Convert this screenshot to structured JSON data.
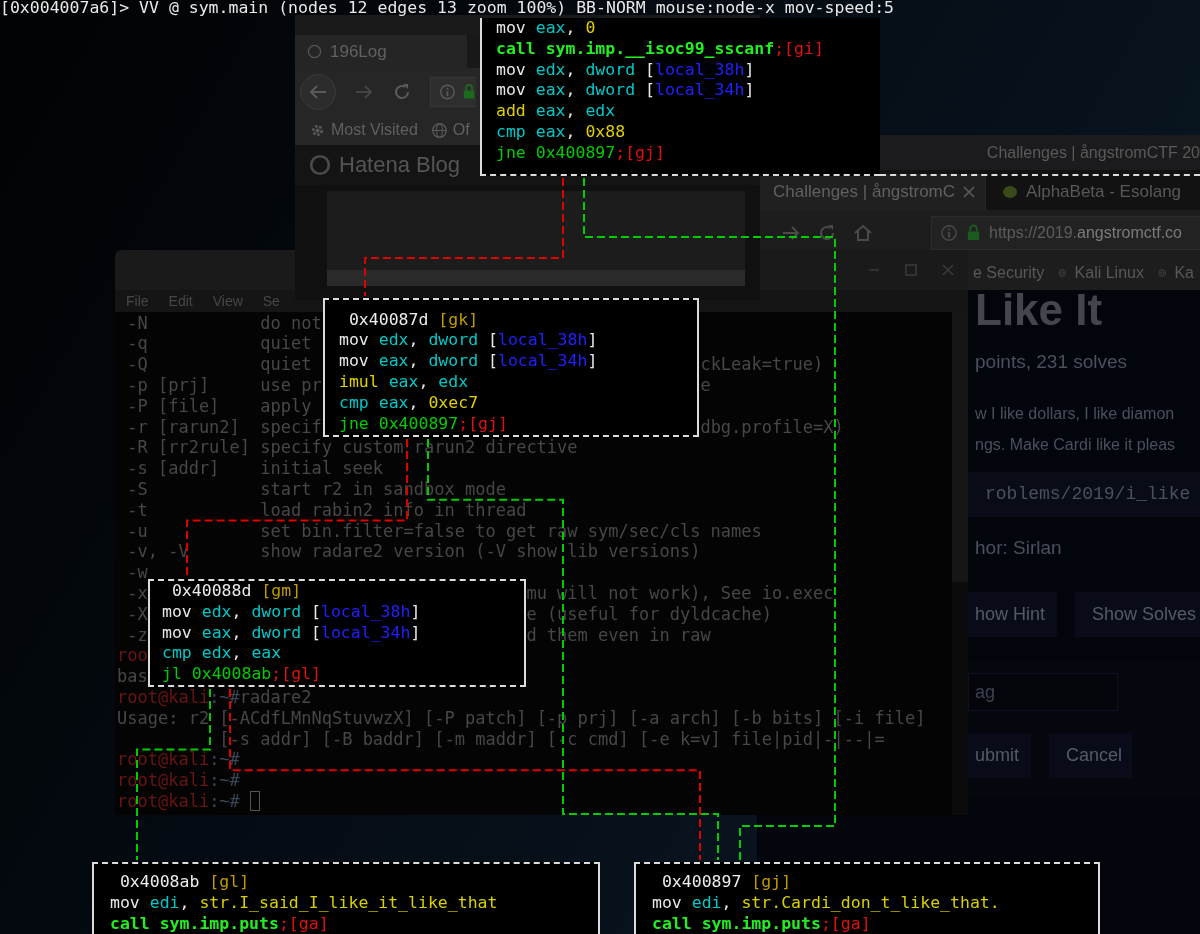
{
  "status_line": "[0x004007a6]> VV @ sym.main (nodes 12 edges 13 zoom 100%) BB-NORM mouse:node-x mov-speed:5",
  "browser_back": {
    "title": "Challenges | ångstromCTF 20",
    "tabs": [
      {
        "label": "Challenges | ångstromC",
        "selected": true
      },
      {
        "label": "AlphaBeta - Esolang",
        "selected": false
      }
    ],
    "url": {
      "dim_part": "https://2019.",
      "domain_part": "angstromctf.co"
    },
    "bookmarks": [
      "e Security",
      "Kali Linux",
      "Ka"
    ],
    "page": {
      "heading": "Like It",
      "meta": "points, 231 solves",
      "description": [
        "w I like dollars, I like diamon",
        "ngs. Make Cardi like it pleas"
      ],
      "path": "roblems/2019/i_like",
      "author": "hor: Sirlan",
      "buttons": [
        "how Hint",
        "Show Solves"
      ],
      "flag_placeholder": "ag",
      "form_buttons": [
        "ubmit",
        "Cancel"
      ]
    }
  },
  "terminal": {
    "menu": [
      "File",
      "Edit",
      "View",
      "Se"
    ],
    "lines": [
      {
        "kind": "help",
        "option": "-N",
        "text": "do not"
      },
      {
        "kind": "help",
        "option": "-q",
        "text": "quiet"
      },
      {
        "kind": "help",
        "option": "-Q",
        "text": "quiet",
        "tail": "ckLeak=true)"
      },
      {
        "kind": "help",
        "option": "-p [prj]",
        "text": "use pr",
        "tail": "e"
      },
      {
        "kind": "help",
        "option": "-P [file]",
        "text": "apply"
      },
      {
        "kind": "help",
        "option": "-r [rarun2]",
        "text": "specif",
        "tail": "dbg.profile=X)"
      },
      {
        "kind": "help",
        "option": "-R [rr2rule]",
        "text": "specify custom rarun2 directive"
      },
      {
        "kind": "help",
        "option": "-s [addr]",
        "text": "initial seek"
      },
      {
        "kind": "help",
        "option": "-S",
        "text": "start r2 in sandbox mode"
      },
      {
        "kind": "help",
        "option": "-t",
        "text": "load rabin2 info in thread"
      },
      {
        "kind": "help",
        "option": "-u",
        "text": "set bin.filter=false to get raw sym/sec/cls names"
      },
      {
        "kind": "help",
        "option": "-v, -V",
        "text": "show radare2 version (-V show lib versions)"
      },
      {
        "kind": "help",
        "option": "-w"
      },
      {
        "kind": "help",
        "option": "-x",
        "tail": "mu will not work), See io.exec"
      },
      {
        "kind": "help",
        "option": "-X",
        "tail": "e (useful for dyldcache)"
      },
      {
        "kind": "help",
        "option": "-z",
        "tail": "d them even in raw"
      },
      {
        "kind": "prompt",
        "user": "roo",
        "cursor": false
      },
      {
        "kind": "output",
        "text": "bas"
      },
      {
        "kind": "prompt",
        "user": "root@kali",
        "path": ":~#",
        "command": "radare2",
        "cursor": false
      },
      {
        "kind": "output",
        "text": "Usage: r2 [-ACdfLMnNqStuvwzX] [-P patch] [-p prj] [-a arch] [-b bits] [-i file]"
      },
      {
        "kind": "continuation",
        "text": "[-s addr] [-B baddr] [-m maddr] [-c cmd] [-e k=v] file|pid|-|--|="
      },
      {
        "kind": "prompt",
        "user": "root@kali",
        "path": ":~#",
        "cursor": false
      },
      {
        "kind": "prompt",
        "user": "root@kali",
        "path": ":~#",
        "cursor": false
      },
      {
        "kind": "prompt",
        "user": "root@kali",
        "path": ":~#",
        "cursor": true
      }
    ]
  },
  "browser_front": {
    "tab": "196Log",
    "bookmarks": [
      "Most Visited",
      "Of"
    ],
    "site_logo": "Hatena Blog"
  },
  "graph": {
    "nodes": [
      {
        "lines": [
          [
            {
              "text": "mov ",
              "kind": "op"
            },
            {
              "text": "eax",
              "kind": "reg"
            },
            {
              "text": ", ",
              "kind": "op"
            },
            {
              "text": "0",
              "kind": "num"
            }
          ],
          [
            {
              "text": "call sym.imp.__isoc99_sscanf",
              "kind": "call"
            },
            {
              "text": ";[gi]",
              "kind": "ref"
            }
          ],
          [
            {
              "text": "mov ",
              "kind": "op"
            },
            {
              "text": "edx",
              "kind": "reg"
            },
            {
              "text": ", ",
              "kind": "op"
            },
            {
              "text": "dword",
              "kind": "reg"
            },
            {
              "text": " [",
              "kind": "op"
            },
            {
              "text": "local_38h",
              "kind": "var"
            },
            {
              "text": "]",
              "kind": "op"
            }
          ],
          [
            {
              "text": "mov ",
              "kind": "op"
            },
            {
              "text": "eax",
              "kind": "reg"
            },
            {
              "text": ", ",
              "kind": "op"
            },
            {
              "text": "dword",
              "kind": "reg"
            },
            {
              "text": " [",
              "kind": "op"
            },
            {
              "text": "local_34h",
              "kind": "var"
            },
            {
              "text": "]",
              "kind": "op"
            }
          ],
          [
            {
              "text": "add ",
              "kind": "arith"
            },
            {
              "text": "eax",
              "kind": "reg"
            },
            {
              "text": ", ",
              "kind": "op"
            },
            {
              "text": "edx",
              "kind": "reg"
            }
          ],
          [
            {
              "text": "cmp ",
              "kind": "cmp"
            },
            {
              "text": "eax",
              "kind": "reg"
            },
            {
              "text": ", ",
              "kind": "op"
            },
            {
              "text": "0x88",
              "kind": "num"
            }
          ],
          [
            {
              "text": "jne 0x400897",
              "kind": "jmp"
            },
            {
              "text": ";[gj]",
              "kind": "ref"
            }
          ]
        ]
      },
      {
        "header": {
          "addr": "0x40087d",
          "label": "[gk]"
        },
        "lines": [
          [
            {
              "text": "mov ",
              "kind": "op"
            },
            {
              "text": "edx",
              "kind": "reg"
            },
            {
              "text": ", ",
              "kind": "op"
            },
            {
              "text": "dword",
              "kind": "reg"
            },
            {
              "text": " [",
              "kind": "op"
            },
            {
              "text": "local_38h",
              "kind": "var"
            },
            {
              "text": "]",
              "kind": "op"
            }
          ],
          [
            {
              "text": "mov ",
              "kind": "op"
            },
            {
              "text": "eax",
              "kind": "reg"
            },
            {
              "text": ", ",
              "kind": "op"
            },
            {
              "text": "dword",
              "kind": "reg"
            },
            {
              "text": " [",
              "kind": "op"
            },
            {
              "text": "local_34h",
              "kind": "var"
            },
            {
              "text": "]",
              "kind": "op"
            }
          ],
          [
            {
              "text": "imul ",
              "kind": "arith"
            },
            {
              "text": "eax",
              "kind": "reg"
            },
            {
              "text": ", ",
              "kind": "op"
            },
            {
              "text": "edx",
              "kind": "reg"
            }
          ],
          [
            {
              "text": "cmp ",
              "kind": "cmp"
            },
            {
              "text": "eax",
              "kind": "reg"
            },
            {
              "text": ", ",
              "kind": "op"
            },
            {
              "text": "0xec7",
              "kind": "num"
            }
          ],
          [
            {
              "text": "jne 0x400897",
              "kind": "jmp"
            },
            {
              "text": ";[gj]",
              "kind": "ref"
            }
          ]
        ]
      },
      {
        "header": {
          "addr": "0x40088d",
          "label": "[gm]"
        },
        "lines": [
          [
            {
              "text": "mov ",
              "kind": "op"
            },
            {
              "text": "edx",
              "kind": "reg"
            },
            {
              "text": ", ",
              "kind": "op"
            },
            {
              "text": "dword",
              "kind": "reg"
            },
            {
              "text": " [",
              "kind": "op"
            },
            {
              "text": "local_38h",
              "kind": "var"
            },
            {
              "text": "]",
              "kind": "op"
            }
          ],
          [
            {
              "text": "mov ",
              "kind": "op"
            },
            {
              "text": "eax",
              "kind": "reg"
            },
            {
              "text": ", ",
              "kind": "op"
            },
            {
              "text": "dword",
              "kind": "reg"
            },
            {
              "text": " [",
              "kind": "op"
            },
            {
              "text": "local_34h",
              "kind": "var"
            },
            {
              "text": "]",
              "kind": "op"
            }
          ],
          [
            {
              "text": "cmp ",
              "kind": "cmp"
            },
            {
              "text": "edx",
              "kind": "reg"
            },
            {
              "text": ", ",
              "kind": "op"
            },
            {
              "text": "eax",
              "kind": "reg"
            }
          ],
          [
            {
              "text": "jl 0x4008ab",
              "kind": "jmp"
            },
            {
              "text": ";[gl]",
              "kind": "ref"
            }
          ]
        ]
      },
      {
        "header": {
          "addr": "0x4008ab",
          "label": "[gl]"
        },
        "lines": [
          [
            {
              "text": "mov ",
              "kind": "op"
            },
            {
              "text": "edi",
              "kind": "reg"
            },
            {
              "text": ", ",
              "kind": "op"
            },
            {
              "text": "str.I_said_I_like_it_like_that",
              "kind": "str"
            }
          ],
          [
            {
              "text": "call sym.imp.puts",
              "kind": "call"
            },
            {
              "text": ";[ga]",
              "kind": "ref"
            }
          ]
        ]
      },
      {
        "header": {
          "addr": "0x400897",
          "label": "[gj]"
        },
        "lines": [
          [
            {
              "text": "mov ",
              "kind": "op"
            },
            {
              "text": "edi",
              "kind": "reg"
            },
            {
              "text": ", ",
              "kind": "op"
            },
            {
              "text": "str.Cardi_don_t_like_that.",
              "kind": "str"
            }
          ],
          [
            {
              "text": "call sym.imp.puts",
              "kind": "call"
            },
            {
              "text": ";[ga]",
              "kind": "ref"
            }
          ]
        ]
      }
    ],
    "edges": [
      {
        "color": "#e00000"
      },
      {
        "color": "#00cc00"
      },
      {
        "color": "#e00000"
      },
      {
        "color": "#00cc00"
      },
      {
        "color": "#00cc00"
      },
      {
        "color": "#e00000"
      }
    ]
  }
}
